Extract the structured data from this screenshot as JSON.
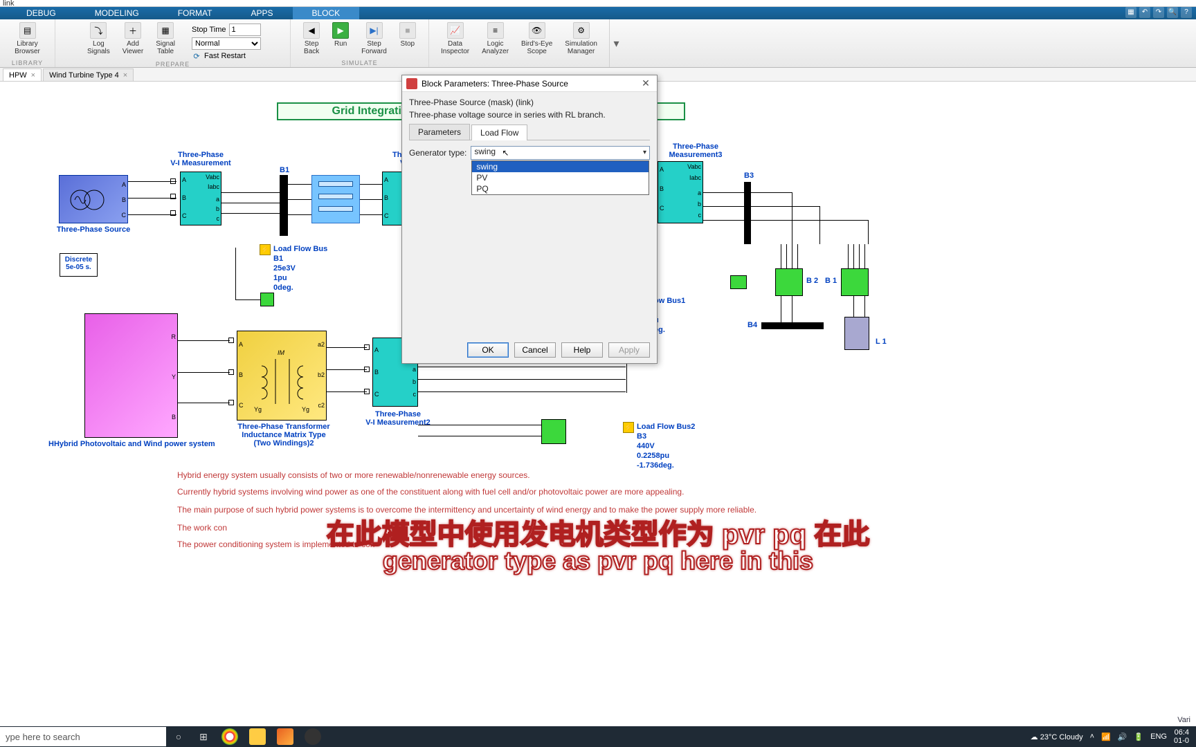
{
  "window_title": "link",
  "ribbon": {
    "tabs": [
      "DEBUG",
      "MODELING",
      "FORMAT",
      "APPS",
      "BLOCK"
    ],
    "active_tab": "BLOCK"
  },
  "toolstrip": {
    "library": {
      "label": "Library\nBrowser",
      "group": "LIBRARY"
    },
    "prepare": {
      "log_signals": "Log\nSignals",
      "add_viewer": "Add\nViewer",
      "signal_table": "Signal\nTable",
      "stop_time_label": "Stop Time",
      "stop_time_value": "1",
      "mode": "Normal",
      "fast_restart": "Fast Restart",
      "group": "PREPARE"
    },
    "simulate": {
      "step_back": "Step\nBack",
      "run": "Run",
      "step_fwd": "Step\nForward",
      "stop": "Stop",
      "group": "SIMULATE"
    },
    "review": {
      "data_inspector": "Data\nInspector",
      "logic_analyzer": "Logic\nAnalyzer",
      "birds_eye": "Bird's-Eye\nScope",
      "sim_mgr": "Simulation\nManager"
    }
  },
  "file_tabs": [
    {
      "label": "HPW"
    },
    {
      "label": "Wind Turbine Type 4"
    }
  ],
  "canvas": {
    "title": "Grid Integration of Hybrid Photovoltaic and Wind system",
    "three_phase_source": "Three-Phase Source",
    "vi_meas": "Three-Phase\nV-I Measurement",
    "vi_meas2": "Three-Phase\nV-I Measurement2",
    "vi_meas3": "Three-Phase\nMeasurement3",
    "discrete": "Discrete\n5e-05 s.",
    "lfb1": {
      "title": "Load Flow Bus",
      "b": "B1",
      "v": "25e3V",
      "pu": "1pu",
      "deg": "0deg."
    },
    "lfb_right": {
      "title": "ow Bus1",
      "b": "",
      "pu": "u",
      "deg": "eg."
    },
    "lfb2": {
      "title": "Load Flow Bus2",
      "b": "B3",
      "v": "440V",
      "pu": "0.2258pu",
      "deg": "-1.736deg."
    },
    "hybrid": "HHybrid Photovoltaic and Wind power system",
    "xfmr": "Three-Phase Transformer\nInductance Matrix Type\n(Two Windings)2",
    "b1": "B1",
    "b2": "B 2",
    "b1r": "B 1",
    "b3": "B3",
    "b4": "B4",
    "l1": "L 1",
    "ports": {
      "A": "A",
      "B": "B",
      "C": "C",
      "a": "a",
      "b": "b",
      "c": "c",
      "R": "R",
      "Y": "Y",
      "Bp": "B",
      "Vabc": "Vabc",
      "Iabc": "Iabc",
      "a2": "a2",
      "b2": "b2",
      "c2": "c2",
      "IM": "IM",
      "Yg": "Yg"
    }
  },
  "dialog": {
    "title": "Block Parameters: Three-Phase Source",
    "mask_title": "Three-Phase Source (mask) (link)",
    "mask_desc": "Three-phase voltage source in series with RL branch.",
    "tabs": [
      "Parameters",
      "Load Flow"
    ],
    "active_tab": "Load Flow",
    "gen_type_label": "Generator type:",
    "gen_type_value": "swing",
    "gen_type_options": [
      "swing",
      "PV",
      "PQ"
    ],
    "buttons": {
      "ok": "OK",
      "cancel": "Cancel",
      "help": "Help",
      "apply": "Apply"
    }
  },
  "description": [
    "Hybrid energy system usually consists of two or more renewable/nonrenewable energy sources.",
    "Currently hybrid systems involving wind power as one of the constituent along with fuel cell and/or photovoltaic power are more appealing.",
    "The main purpose of such hybrid power systems is to overcome the intermittency and uncertainty of wind energy and to make the power supply more reliable.",
    "The work con",
    "The power conditioning system is implemented to con"
  ],
  "subtitles": {
    "cn": "在此模型中使用发电机类型作为 pvr pq 在此",
    "en": "generator type as pvr pq here in this"
  },
  "taskbar": {
    "search_placeholder": "ype here to search",
    "weather": "23°C  Cloudy",
    "lang": "ENG",
    "time": "06:4",
    "date": "01-0"
  },
  "statusbar_right": "Vari"
}
